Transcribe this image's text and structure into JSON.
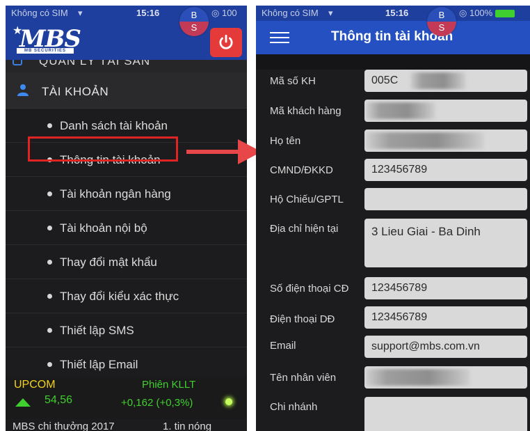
{
  "left": {
    "status": {
      "carrier": "Không có SIM",
      "time": "15:16",
      "battery": "100"
    },
    "logo": {
      "text": "MBS",
      "sub": "MB SECURITIES"
    },
    "badge": {
      "top": "B",
      "bottom": "S"
    },
    "cut_menu_label": "QUẢN LÝ TÀI SẢN",
    "account_label": "TÀI KHOẢN",
    "submenu": [
      {
        "label": "Danh sách tài khoản"
      },
      {
        "label": "Thông tin tài khoản"
      },
      {
        "label": "Tài khoản ngân hàng"
      },
      {
        "label": "Tài khoản nội bộ"
      },
      {
        "label": "Thay đổi mật khẩu"
      },
      {
        "label": "Thay đổi kiểu xác thực"
      },
      {
        "label": "Thiết lập SMS"
      },
      {
        "label": "Thiết lập Email"
      }
    ],
    "ticker": {
      "name": "UPCOM",
      "session": "Phiên KLLT",
      "index": "54,56",
      "change": "+0,162 (+0,3%)"
    },
    "news": {
      "item1": "MBS chi thưởng 2017",
      "item2": "1. tin nóng"
    }
  },
  "right": {
    "status": {
      "carrier": "Không có SIM",
      "time": "15:16",
      "battery": "100%"
    },
    "badge": {
      "top": "B",
      "bottom": "S"
    },
    "title": "Thông tin tài khoản",
    "fields": [
      {
        "label": "Mã số KH",
        "value": "005C"
      },
      {
        "label": "Mã khách hàng",
        "value": ""
      },
      {
        "label": "Họ tên",
        "value": ""
      },
      {
        "label": "CMND/ĐKKD",
        "value": "123456789"
      },
      {
        "label": "Hộ Chiếu/GPTL",
        "value": ""
      },
      {
        "label": "Địa chỉ hiện tại",
        "value": "3 Lieu Giai - Ba Dinh"
      },
      {
        "label": "Số điện thoại CĐ",
        "value": "123456789"
      },
      {
        "label": "Điện thoại DĐ",
        "value": "123456789"
      },
      {
        "label": "Email",
        "value": "support@mbs.com.vn"
      },
      {
        "label": "Tên nhân viên",
        "value": ""
      },
      {
        "label": "Chi nhánh",
        "value": ""
      }
    ]
  },
  "colors": {
    "header_blue": "#1f3f9e",
    "title_bar_blue": "#2450c2",
    "highlight_red": "#e02424",
    "upcom_yellow": "#f2d21a",
    "up_green": "#3fcf2e"
  }
}
